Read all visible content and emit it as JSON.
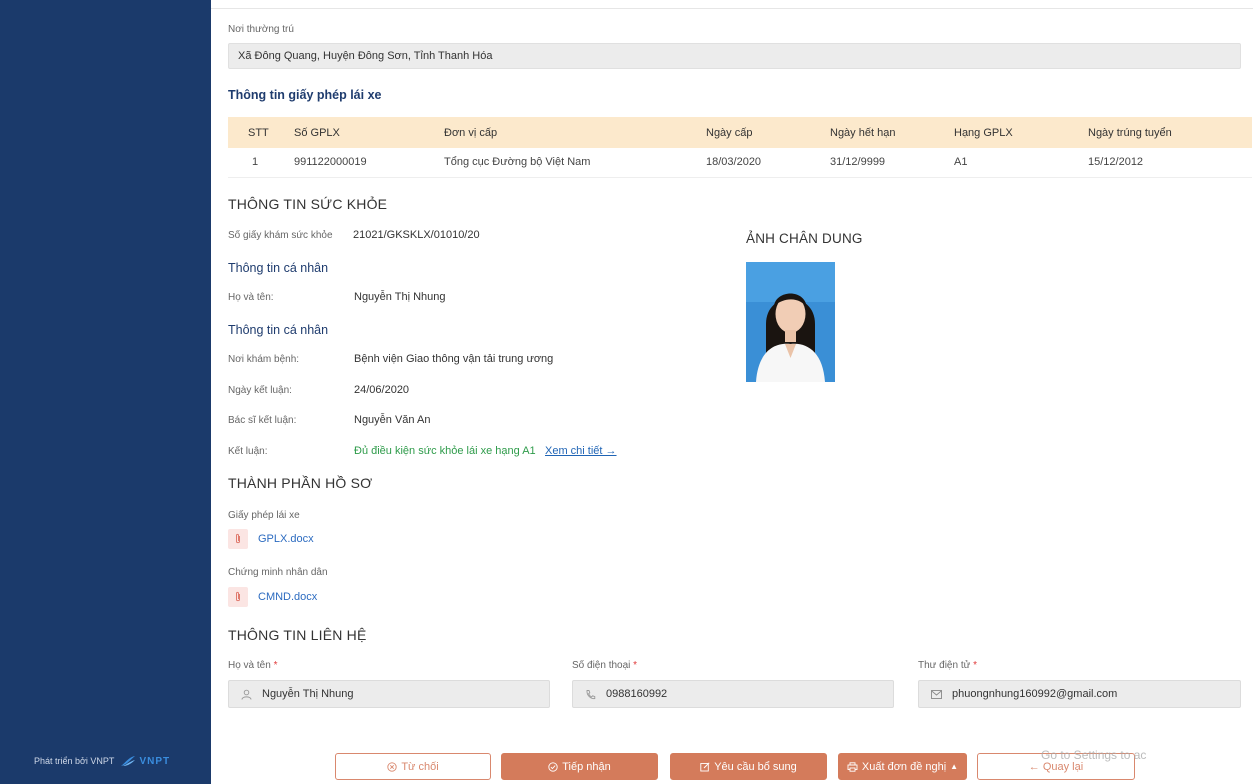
{
  "sidebar": {
    "footer_text": "Phát triển bởi VNPT",
    "logo_text": "VNPT"
  },
  "residence": {
    "label": "Nơi thường trú",
    "value": "Xã Đông Quang, Huyện Đông Sơn, Tỉnh Thanh Hóa"
  },
  "license_section": {
    "title": "Thông tin giấy phép lái xe",
    "columns": [
      "STT",
      "Số GPLX",
      "Đơn vị cấp",
      "Ngày cấp",
      "Ngày hết hạn",
      "Hạng GPLX",
      "Ngày trúng tuyển"
    ],
    "rows": [
      [
        "1",
        "991122000019",
        "Tổng cục Đường bộ Việt Nam",
        "18/03/2020",
        "31/12/9999",
        "A1",
        "15/12/2012"
      ]
    ]
  },
  "health": {
    "title": "THÔNG TIN SỨC KHỎE",
    "cert_label": "Số giấy khám sức khỏe",
    "cert_value": "21021/GKSKLX/01010/20",
    "personal_title": "Thông tin cá nhân",
    "name_label": "Họ và tên:",
    "name_value": "Nguyễn Thị Nhung",
    "personal_title_2": "Thông tin cá nhân",
    "place_label": "Nơi khám bệnh:",
    "place_value": "Bệnh viện Giao thông vận tải trung ương",
    "date_label": "Ngày kết luận:",
    "date_value": "24/06/2020",
    "doctor_label": "Bác sĩ kết luận:",
    "doctor_value": "Nguyễn Văn An",
    "conclusion_label": "Kết luận:",
    "conclusion_value": "Đủ điều kiện sức khỏe lái xe hạng A1",
    "detail_link": "Xem chi tiết →",
    "portrait_title": "ẢNH CHÂN DUNG"
  },
  "documents": {
    "title": "THÀNH PHẦN HỒ SƠ",
    "items": [
      {
        "label": "Giấy phép lái xe",
        "file": "GPLX.docx"
      },
      {
        "label": "Chứng minh nhân dân",
        "file": "CMND.docx"
      }
    ]
  },
  "contact": {
    "title": "THÔNG TIN LIÊN HỆ",
    "name_label": "Họ và tên",
    "name_value": "Nguyễn Thị Nhung",
    "phone_label": "Số điện thoại",
    "phone_value": "0988160992",
    "email_label": "Thư điện tử",
    "email_value": "phuongnhung160992@gmail.com",
    "required_mark": "*"
  },
  "actions": {
    "reject": "Từ chối",
    "accept": "Tiếp nhận",
    "request_more": "Yêu cầu bổ sung",
    "export": "Xuất đơn đề nghị",
    "back": "← Quay lại"
  },
  "watermark": "Go to Settings to ac",
  "colors": {
    "sidebar": "#1b3a6b",
    "accent": "#d47b5b",
    "table_header": "#fce9cc",
    "success": "#2e9b4a",
    "link": "#1f64b5"
  }
}
